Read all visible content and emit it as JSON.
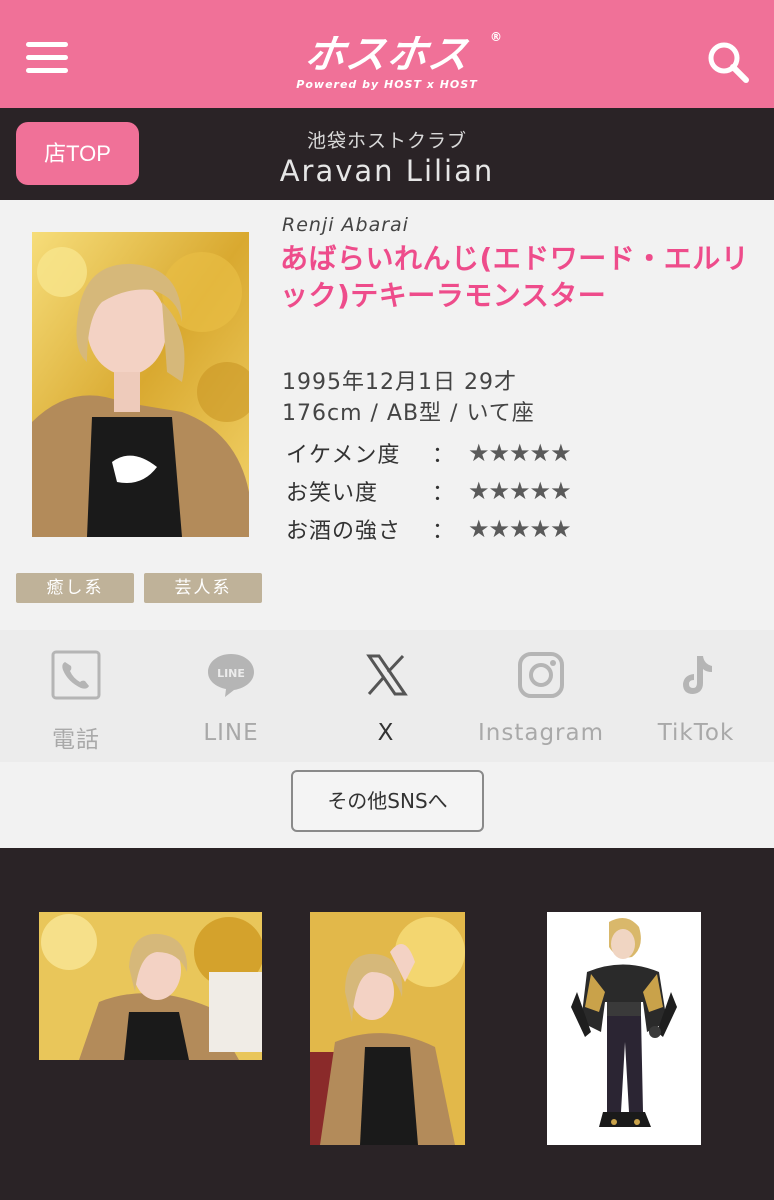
{
  "header": {
    "logo_main": "ホスホス",
    "logo_reg": "®",
    "logo_sub": "Powered by HOST x HOST"
  },
  "store": {
    "top_button": "店TOP",
    "category": "池袋ホストクラブ",
    "name": "Aravan Lilian"
  },
  "profile": {
    "romaji": "Renji Abarai",
    "name": "あばらいれんじ(エドワード・エルリック)テキーラモンスター",
    "birth": "1995年12月1日 29才",
    "spec": "176cm / AB型 / いて座",
    "ratings": [
      {
        "label": "イケメン度",
        "colon": "：",
        "stars": "★★★★★"
      },
      {
        "label": "お笑い度",
        "colon": "：",
        "stars": "★★★★★"
      },
      {
        "label": "お酒の強さ",
        "colon": "：",
        "stars": "★★★★★"
      }
    ],
    "tags": [
      "癒し系",
      "芸人系"
    ]
  },
  "sns": {
    "items": [
      {
        "label": "電話",
        "icon": "phone-icon"
      },
      {
        "label": "LINE",
        "icon": "line-icon"
      },
      {
        "label": "X",
        "icon": "x-icon"
      },
      {
        "label": "Instagram",
        "icon": "instagram-icon"
      },
      {
        "label": "TikTok",
        "icon": "tiktok-icon"
      }
    ],
    "other_button": "その他SNSへ"
  },
  "colors": {
    "brand_pink": "#f07198",
    "name_pink": "#ee4c8b",
    "dark_bg": "#2a2326",
    "tag_beige": "#bfb299"
  }
}
